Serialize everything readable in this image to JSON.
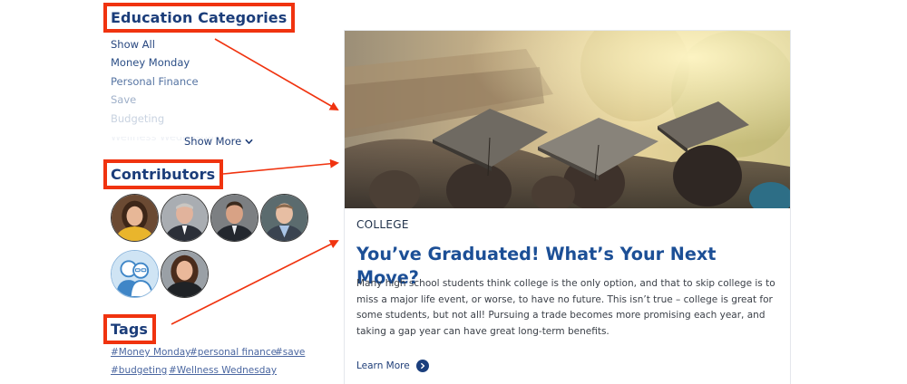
{
  "sidebar": {
    "categories_heading": "Education Categories",
    "categories": [
      "Show All",
      "Money Monday",
      "Personal Finance",
      "Save",
      "Budgeting",
      "Wellness Wednesday"
    ],
    "show_more_label": "Show More",
    "contributors_heading": "Contributors",
    "tags_heading": "Tags",
    "tags": [
      "#Money Monday",
      "#personal finance",
      "#save",
      "#budgeting",
      "#Wellness Wednesday"
    ]
  },
  "card": {
    "category": "COLLEGE",
    "title": "You’ve Graduated! What’s Your Next Move?",
    "excerpt": "Many high school students think college is the only option, and that to skip college is to miss a major life event, or worse, to have no future. This isn’t true – college is great for some students, but not all! Pursuing a trade becomes more promising each year, and taking a gap year can have great long-term benefits.",
    "learn_more_label": "Learn More"
  },
  "colors": {
    "heading_blue": "#1b3d7a",
    "title_blue": "#1c4f96",
    "annotation_red": "#f0330f"
  },
  "icons": [
    "chevron-down-icon",
    "arrow-right-icon"
  ]
}
